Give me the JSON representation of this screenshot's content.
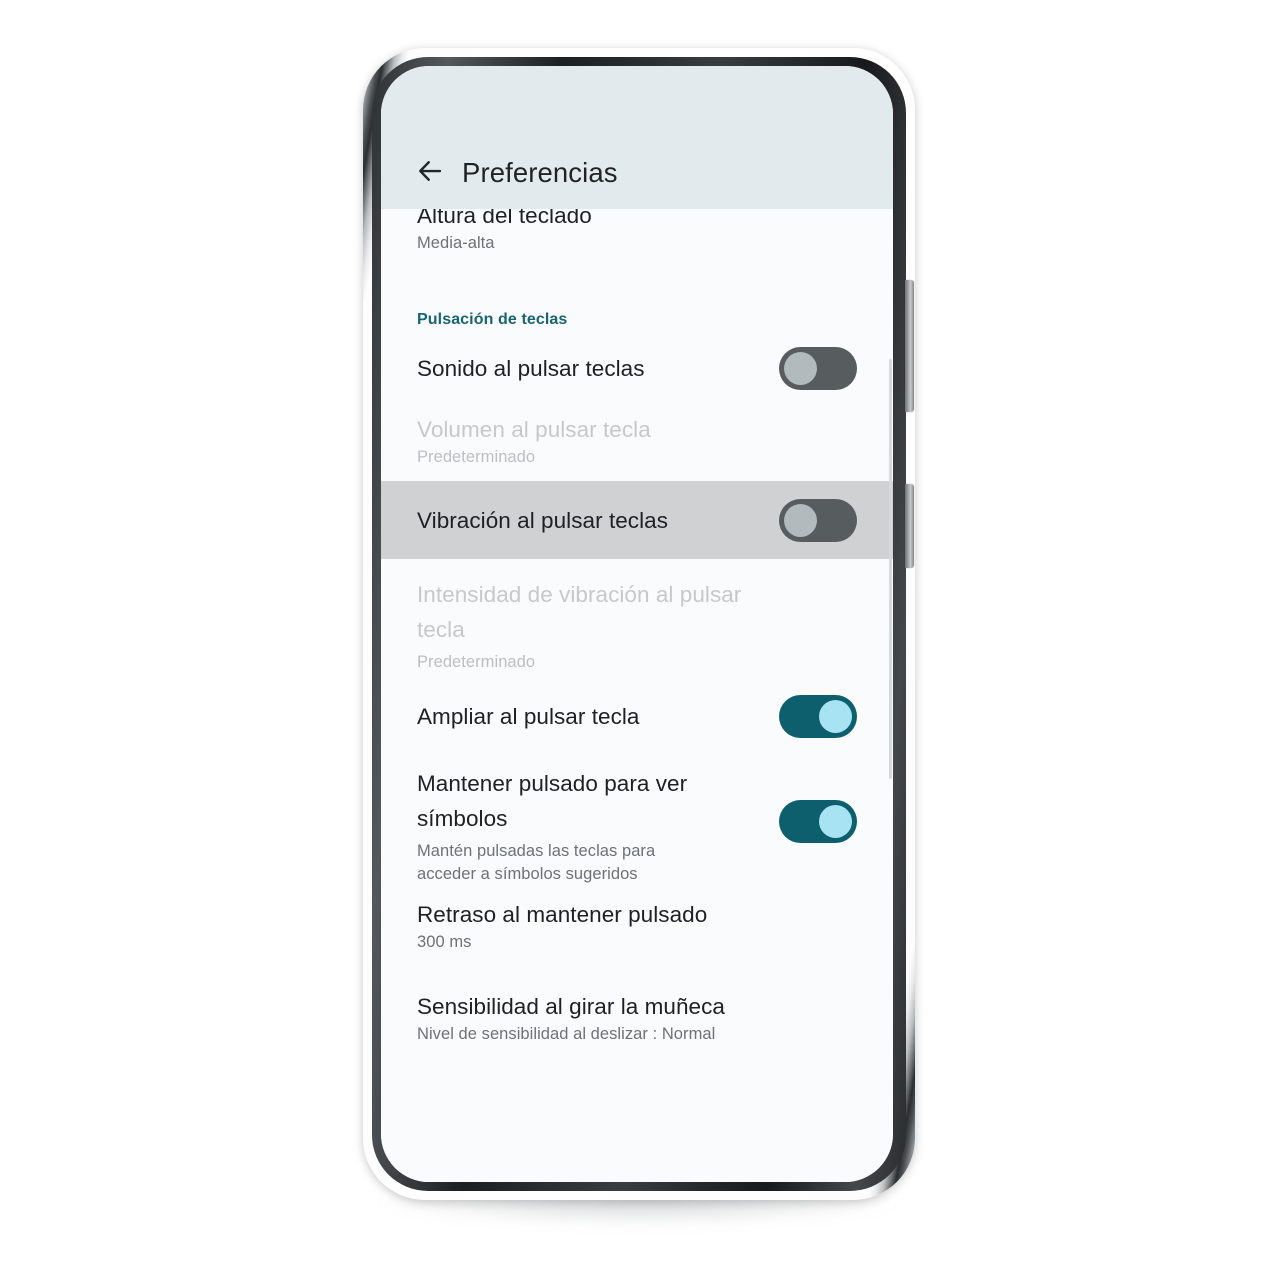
{
  "device": {
    "side_buttons": [
      "volume-rocker",
      "power-button"
    ]
  },
  "app": {
    "toolbar": {
      "back_icon": "back-arrow-icon",
      "title": "Preferencias"
    },
    "accent_color": "#0e5f6e",
    "section_header_color": "#1a6470",
    "toolbar_background": "#e3eaed",
    "screen_background": "#fafbfc",
    "highlight_row_background": "#cfd1d2",
    "rows": [
      {
        "id": "keyboard-height",
        "title": "Altura del teclado",
        "subtitle": "Media-alta",
        "type": "value",
        "disabled": false,
        "clipped_top": true
      },
      {
        "id": "keypress-section",
        "title": "Pulsación de teclas",
        "type": "section-header"
      },
      {
        "id": "keypress-sound",
        "title": "Sonido al pulsar teclas",
        "subtitle": "",
        "type": "switch",
        "switch_state": "off",
        "disabled": false
      },
      {
        "id": "keypress-volume",
        "title": "Volumen al pulsar tecla",
        "subtitle": "Predeterminado",
        "type": "value",
        "disabled": true
      },
      {
        "id": "keypress-vibration",
        "title": "Vibración al pulsar teclas",
        "subtitle": "",
        "type": "switch",
        "switch_state": "off",
        "disabled": false,
        "highlighted": true
      },
      {
        "id": "keypress-vibration-strength",
        "title": "Intensidad de vibración al pulsar tecla",
        "subtitle": "Predeterminado",
        "type": "value",
        "disabled": true
      },
      {
        "id": "popup-on-keypress",
        "title": "Ampliar al pulsar tecla",
        "subtitle": "",
        "type": "switch",
        "switch_state": "on",
        "disabled": false
      },
      {
        "id": "long-press-symbols",
        "title": "Mantener pulsado para ver símbolos",
        "subtitle": "Mantén pulsadas las teclas para acceder a símbolos sugeridos",
        "type": "switch",
        "switch_state": "on",
        "disabled": false
      },
      {
        "id": "long-press-delay",
        "title": "Retraso al mantener pulsado",
        "subtitle": "300 ms",
        "type": "value",
        "disabled": false
      },
      {
        "id": "wrist-turn-sensitivity",
        "title": "Sensibilidad al girar la muñeca",
        "subtitle": "Nivel de sensibilidad al deslizar : Normal",
        "type": "value",
        "disabled": false
      }
    ]
  }
}
